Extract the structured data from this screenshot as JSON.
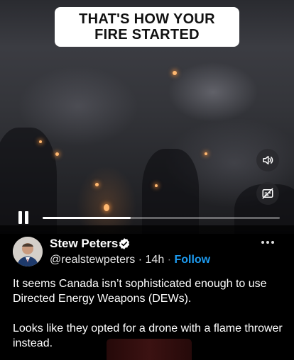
{
  "video": {
    "caption": {
      "line1": "THAT'S HOW YOUR",
      "line2": "FIRE STARTED"
    },
    "controls": {
      "volume_icon": "speaker-icon",
      "captions_icon": "captions-off-icon",
      "playback_icon": "pause-icon",
      "progress_fraction": 0.37
    }
  },
  "post": {
    "author": {
      "name": "Stew Peters",
      "handle": "@realstewpeters",
      "separator": "·",
      "time": "14h",
      "follow_label": "Follow",
      "verified_icon": "verified-badge-icon",
      "avatar": "avatar"
    },
    "more_icon": "more-options-icon",
    "text": "It seems Canada isn’t sophisticated enough to use Directed Energy Weapons (DEWs).\n\nLooks like they opted for a drone with a flame thrower instead."
  },
  "colors": {
    "follow": "#1d9bf0",
    "verified": "#ffffff",
    "background": "#000000"
  }
}
